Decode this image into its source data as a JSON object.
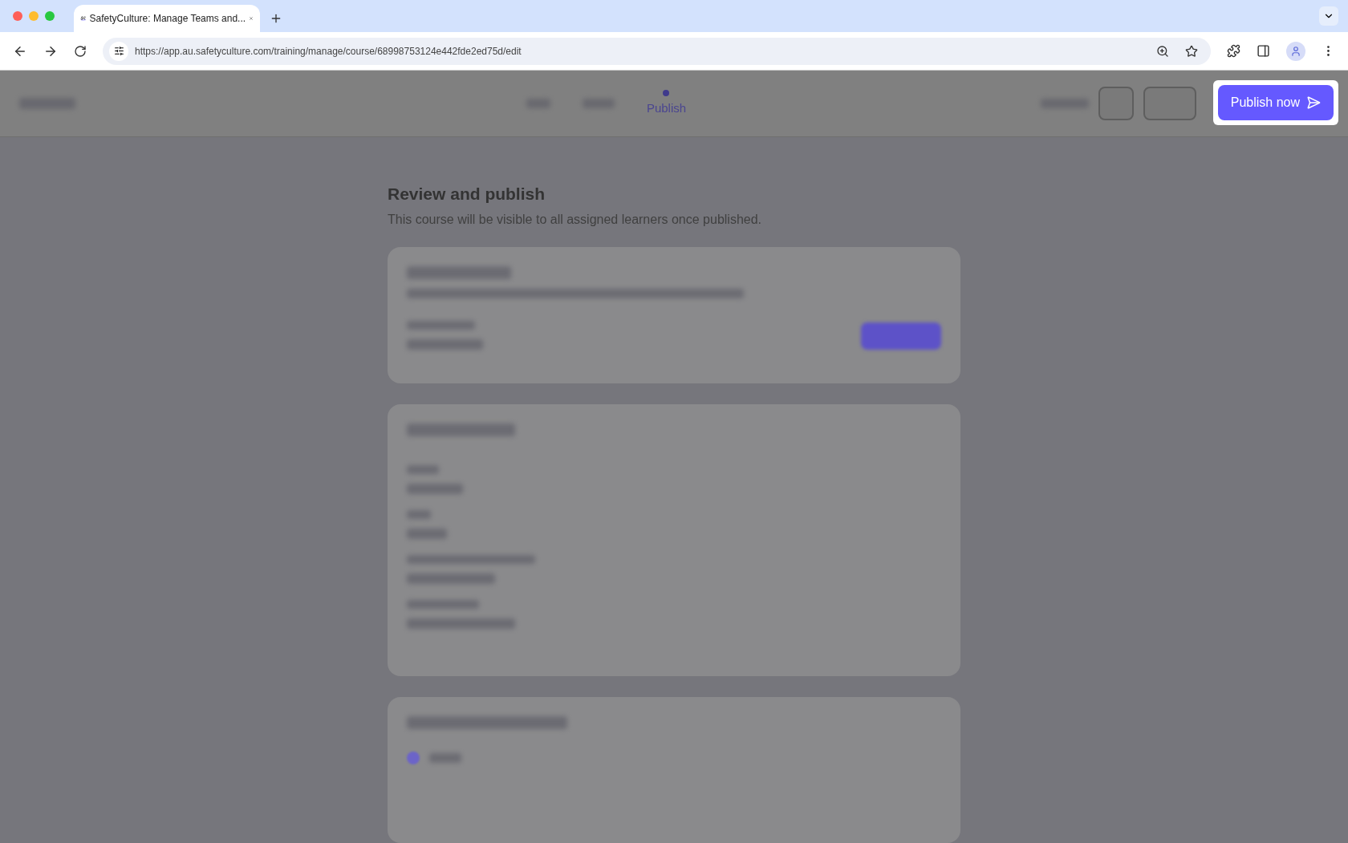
{
  "browser": {
    "tab_title": "SafetyCulture: Manage Teams and...",
    "url": "https://app.au.safetyculture.com/training/manage/course/68998753124e442fde2ed75d/edit"
  },
  "header": {
    "current_step": "Publish",
    "primary_button": "Publish now"
  },
  "page": {
    "title": "Review and publish",
    "subtitle": "This course will be visible to all assigned learners once published."
  },
  "schedule": {
    "option_selected": true
  }
}
